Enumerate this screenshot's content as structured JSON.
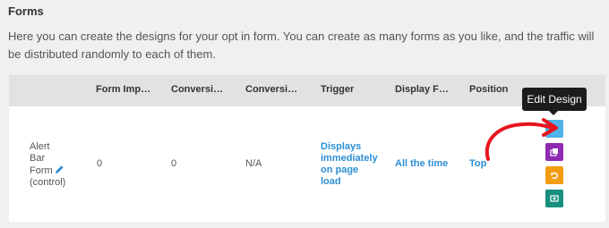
{
  "section": {
    "title": "Forms",
    "description": "Here you can create the designs for your opt in form. You can create as many forms as you like, and the traffic will be distributed randomly to each of them."
  },
  "table": {
    "headers": [
      "Form Imp…",
      "Conversi…",
      "Conversi…",
      "Trigger",
      "Display F…",
      "Position"
    ],
    "row": {
      "name_lines": [
        "Alert",
        "Bar",
        "Form"
      ],
      "name_suffix": "(control)",
      "impressions": "0",
      "conversions": "0",
      "conversion_rate": "N/A",
      "trigger_lines": [
        "Displays",
        "immediately",
        "on page",
        "load"
      ],
      "display_frequency": "All the time",
      "position": "Top"
    }
  },
  "tooltip": {
    "text": "Edit Design"
  },
  "actions": {
    "edit_color": "#4fb3e8",
    "duplicate_color": "#8e2bb0",
    "reset_color": "#f39c12",
    "preview_color": "#18907e"
  },
  "annotation": {
    "arrow_color": "#e8141e"
  }
}
